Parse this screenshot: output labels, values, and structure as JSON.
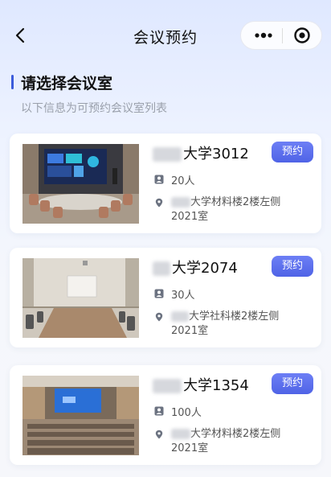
{
  "nav": {
    "title": "会议预约"
  },
  "section": {
    "title": "请选择会议室",
    "subtitle": "以下信息为可预约会议室列表"
  },
  "rooms": [
    {
      "name_visible": "大学3012",
      "capacity": "20人",
      "address_line1": "大学材料楼2楼左侧",
      "address_line2": "2021室",
      "book_label": "预约"
    },
    {
      "name_visible": "大学2074",
      "capacity": "30人",
      "address_line1": "大学社科楼2楼左侧",
      "address_line2": "2021室",
      "book_label": "预约"
    },
    {
      "name_visible": "大学1354",
      "capacity": "100人",
      "address_line1": "大学材料楼2楼左侧",
      "address_line2": "2021室",
      "book_label": "预约"
    }
  ],
  "colors": {
    "accent": "#4f63e6",
    "bg_top": "#dfe8ff"
  }
}
